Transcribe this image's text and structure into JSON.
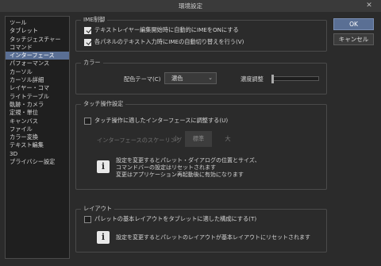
{
  "window": {
    "title": "環境設定",
    "close_glyph": "✕"
  },
  "sidebar": {
    "items": [
      {
        "label": "ツール",
        "active": false
      },
      {
        "label": "タブレット",
        "active": false
      },
      {
        "label": "タッチジェスチャー",
        "active": false
      },
      {
        "label": "コマンド",
        "active": false
      },
      {
        "label": "インターフェース",
        "active": true
      },
      {
        "label": "パフォーマンス",
        "active": false
      },
      {
        "label": "カーソル",
        "active": false
      },
      {
        "label": "カーソル詳細",
        "active": false
      },
      {
        "label": "レイヤー・コマ",
        "active": false
      },
      {
        "label": "ライトテーブル",
        "active": false
      },
      {
        "label": "軌跡・カメラ",
        "active": false
      },
      {
        "label": "定規・単位",
        "active": false
      },
      {
        "label": "キャンバス",
        "active": false
      },
      {
        "label": "ファイル",
        "active": false
      },
      {
        "label": "カラー変換",
        "active": false
      },
      {
        "label": "テキスト編集",
        "active": false
      },
      {
        "label": "3D",
        "active": false
      },
      {
        "label": "プライバシー設定",
        "active": false
      }
    ]
  },
  "ime": {
    "title": "IME制御",
    "option1": "テキストレイヤー編集開始時に自動的にIMEをONにする",
    "option1_checked": true,
    "option2": "各パネルのテキスト入力時にIMEの自動切り替えを行う(V)",
    "option2_checked": true
  },
  "color": {
    "title": "カラー",
    "theme_label": "配色テーマ(C)",
    "theme_value": "濃色",
    "density_label": "濃度調整",
    "density_level": 0
  },
  "touch": {
    "title": "タッチ操作設定",
    "option": "タッチ操作に適したインターフェースに調整する(U)",
    "option_checked": false,
    "scaling_label": "インターフェースのスケーリング",
    "scale_small": "小",
    "scale_standard": "標準",
    "scale_large": "大",
    "info_line1": "設定を変更するとパレット・ダイアログの位置とサイズ、",
    "info_line2": "コマンドバーの設定はリセットされます",
    "info_line3": "変更はアプリケーション再起動後に有効になります"
  },
  "layout": {
    "title": "レイアウト",
    "option": "パレットの基本レイアウトをタブレットに適した構成にする(T)",
    "option_checked": false,
    "info": "設定を変更するとパレットのレイアウトが基本レイアウトにリセットされます"
  },
  "buttons": {
    "ok": "OK",
    "cancel": "キャンセル"
  },
  "icons": {
    "info": "i",
    "dropdown": "⌄"
  }
}
